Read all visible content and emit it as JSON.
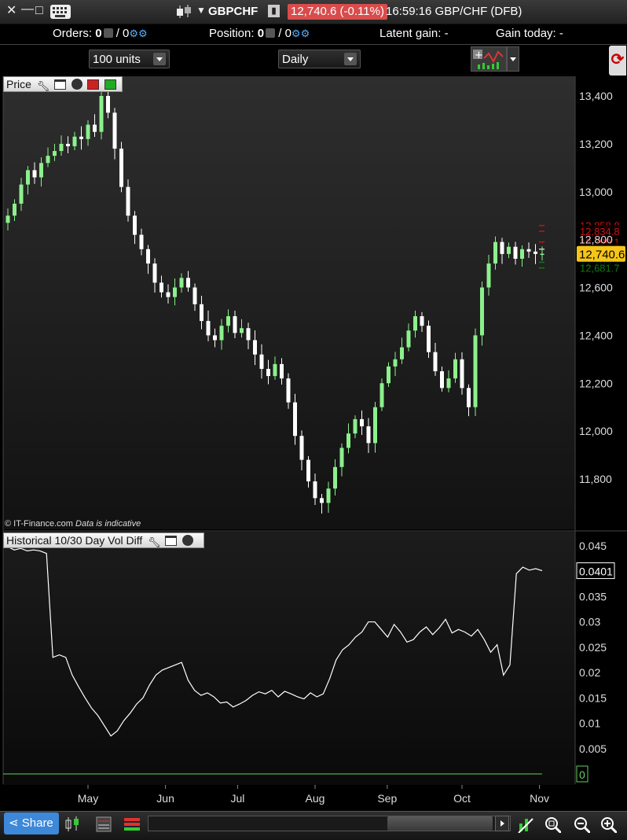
{
  "window": {
    "minimize_glyph": "—",
    "maximize_glyph": "□",
    "close_glyph": "✕"
  },
  "header": {
    "symbol": "GBPCHF",
    "price_change": "12,740.6 (-0.11%)",
    "time_symbol": "16:59:16 GBP/CHF (DFB)"
  },
  "orders_bar": {
    "orders_label": "Orders:",
    "orders_a": "0",
    "orders_b": "/ 0",
    "position_label": "Position:",
    "position_a": "0",
    "position_b": "/ 0",
    "latent_gain": "Latent gain: -",
    "gain_today": "Gain today: -"
  },
  "toolbar": {
    "units_value": "100 units",
    "period_value": "Daily"
  },
  "price_panel": {
    "title": "Price",
    "y_ticks": [
      "13,400",
      "13,200",
      "13,000",
      "12,800",
      "12,600",
      "12,400",
      "12,200",
      "12,000",
      "11,800"
    ],
    "y_tick_values": [
      13400,
      13200,
      13000,
      12800,
      12600,
      12400,
      12200,
      12000,
      11800
    ],
    "current_price": "12,740.6",
    "levels": [
      {
        "label": "12,858.8",
        "value": 12858.8,
        "color": "#cc1111"
      },
      {
        "label": "12,834.8",
        "value": 12834.8,
        "color": "#cc1111"
      },
      {
        "label": "12,790.1",
        "value": 12790.1,
        "color": "#cc1111"
      },
      {
        "label": "12,760.1",
        "value": 12760.1,
        "color": "#cccccc"
      },
      {
        "label": "12,705.2",
        "value": 12705.2,
        "color": "#117711"
      },
      {
        "label": "12,681.7",
        "value": 12681.7,
        "color": "#117711"
      }
    ],
    "credit": "© IT-Finance.com",
    "credit_note": "Data is indicative"
  },
  "indicator_panel": {
    "title": "Historical 10/30 Day Vol Diff",
    "y_ticks": [
      "0.045",
      "0.04",
      "0.035",
      "0.03",
      "0.025",
      "0.02",
      "0.015",
      "0.01",
      "0.005",
      "0"
    ],
    "y_tick_values": [
      0.045,
      0.04,
      0.035,
      0.03,
      0.025,
      0.02,
      0.015,
      0.01,
      0.005,
      0
    ],
    "current_value": "0.0401",
    "zero_label": "0"
  },
  "x_axis": {
    "labels": [
      "May",
      "Jun",
      "Jul",
      "Aug",
      "Sep",
      "Oct",
      "Nov"
    ]
  },
  "bottom_bar": {
    "share_label": "Share"
  },
  "colors": {
    "up": "#8cf08c",
    "down": "#ffffff",
    "price_tag": "#f5c518",
    "accent": "#3d88d8",
    "neg_change": "#d84c4c"
  },
  "chart_data": [
    {
      "type": "candlestick",
      "title": "Price",
      "ylim": [
        11650,
        13500
      ],
      "x_ticks": [
        "May",
        "Jun",
        "Jul",
        "Aug",
        "Sep",
        "Oct",
        "Nov"
      ],
      "close_series": [
        12900,
        12950,
        13030,
        13090,
        13060,
        13120,
        13150,
        13170,
        13200,
        13190,
        13230,
        13220,
        13280,
        13250,
        13400,
        13330,
        13180,
        13020,
        12900,
        12820,
        12760,
        12700,
        12620,
        12580,
        12560,
        12600,
        12640,
        12600,
        12530,
        12460,
        12400,
        12380,
        12440,
        12480,
        12410,
        12430,
        12380,
        12320,
        12260,
        12230,
        12280,
        12220,
        12120,
        11980,
        11880,
        11790,
        11720,
        11700,
        11760,
        11850,
        11930,
        11990,
        12050,
        12020,
        11950,
        12100,
        12200,
        12270,
        12300,
        12350,
        12420,
        12480,
        12440,
        12330,
        12250,
        12180,
        12220,
        12300,
        12180,
        12100,
        12400,
        12600,
        12700,
        12790,
        12740,
        12770,
        12720,
        12760,
        12750,
        12740,
        12741
      ],
      "last": 12740.6
    },
    {
      "type": "line",
      "title": "Historical 10/30 Day Vol Diff",
      "ylim": [
        0,
        0.047
      ],
      "x_ticks": [
        "May",
        "Jun",
        "Jul",
        "Aug",
        "Sep",
        "Oct",
        "Nov"
      ],
      "values": [
        0.0448,
        0.0442,
        0.0445,
        0.044,
        0.0442,
        0.044,
        0.0435,
        0.023,
        0.0235,
        0.023,
        0.0195,
        0.0172,
        0.015,
        0.013,
        0.0115,
        0.0095,
        0.0075,
        0.0085,
        0.0105,
        0.012,
        0.0138,
        0.015,
        0.0175,
        0.0195,
        0.0205,
        0.021,
        0.0215,
        0.022,
        0.0185,
        0.0165,
        0.0155,
        0.016,
        0.0152,
        0.014,
        0.0142,
        0.0132,
        0.0138,
        0.0145,
        0.0155,
        0.0162,
        0.0158,
        0.0165,
        0.0152,
        0.0163,
        0.0158,
        0.0152,
        0.0148,
        0.016,
        0.0152,
        0.0158,
        0.0188,
        0.0225,
        0.0245,
        0.0255,
        0.027,
        0.028,
        0.03,
        0.03,
        0.0285,
        0.027,
        0.0295,
        0.028,
        0.026,
        0.0265,
        0.028,
        0.029,
        0.0275,
        0.0288,
        0.0305,
        0.0278,
        0.0285,
        0.028,
        0.0272,
        0.0285,
        0.0265,
        0.024,
        0.0255,
        0.0195,
        0.0215,
        0.0395,
        0.0408,
        0.0402,
        0.0405,
        0.0401
      ]
    }
  ]
}
